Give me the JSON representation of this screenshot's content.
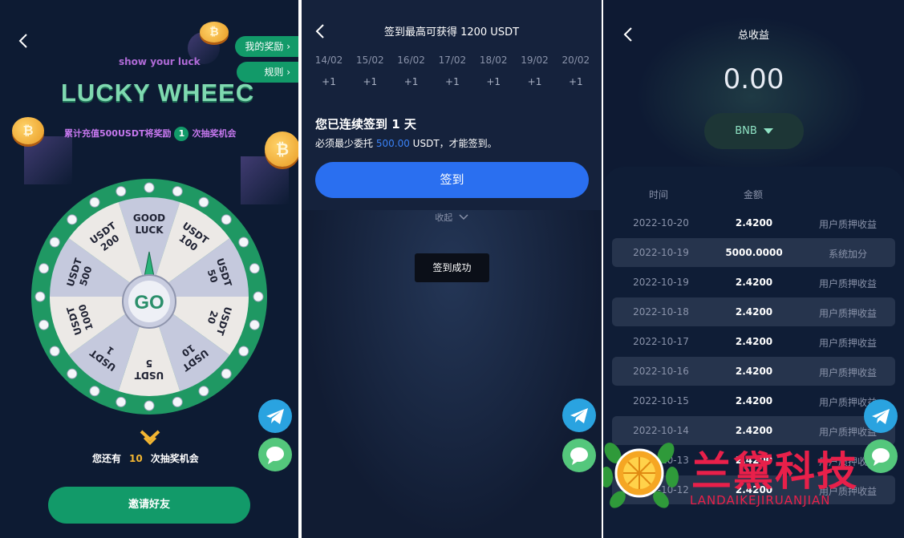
{
  "lucky_wheel": {
    "back_glyph": "‹",
    "my_rewards": "我的奖励",
    "rules": "规则",
    "subtitle": "show your luck",
    "title": "LUCKY WHEEC",
    "promo_prefix": "累计充值500USDT将奖励",
    "promo_count": "1",
    "promo_suffix": "次抽奖机会",
    "wheel_segments": [
      "GOOD LUCK",
      "USDT 100",
      "USDT 50",
      "USDT 20",
      "USDT 10",
      "USDT 5",
      "USDT 1",
      "USDT 1000",
      "USDT 500",
      "USDT 200"
    ],
    "go_label": "GO",
    "remain_prefix": "您还有",
    "remain_count": "10",
    "remain_suffix": "次抽奖机会",
    "invite_label": "邀请好友",
    "colors": {
      "accent": "#129a69",
      "bg": "#0d1b33"
    }
  },
  "checkin": {
    "back_glyph": "‹",
    "title": "签到最高可获得 1200 USDT",
    "days": [
      {
        "date": "14/02",
        "bonus": "+1"
      },
      {
        "date": "15/02",
        "bonus": "+1"
      },
      {
        "date": "16/02",
        "bonus": "+1"
      },
      {
        "date": "17/02",
        "bonus": "+1"
      },
      {
        "date": "18/02",
        "bonus": "+1"
      },
      {
        "date": "19/02",
        "bonus": "+1"
      },
      {
        "date": "20/02",
        "bonus": "+1"
      }
    ],
    "consecutive": "您已连续签到 1 天",
    "need_prefix": "必须最少委托",
    "need_amount": "500.00",
    "need_suffix": "USDT，才能签到。",
    "sign_button": "签到",
    "collapse": "收起",
    "toast": "签到成功",
    "colors": {
      "button": "#2a6ff0"
    }
  },
  "earnings": {
    "back_glyph": "‹",
    "title": "总收益",
    "total": "0.00",
    "coin": "BNB",
    "headers": {
      "time": "时间",
      "amount": "金额"
    },
    "rows": [
      {
        "date": "2022-10-20",
        "amount": "2.4200",
        "type": "用户质押收益"
      },
      {
        "date": "2022-10-19",
        "amount": "5000.0000",
        "type": "系统加分"
      },
      {
        "date": "2022-10-19",
        "amount": "2.4200",
        "type": "用户质押收益"
      },
      {
        "date": "2022-10-18",
        "amount": "2.4200",
        "type": "用户质押收益"
      },
      {
        "date": "2022-10-17",
        "amount": "2.4200",
        "type": "用户质押收益"
      },
      {
        "date": "2022-10-16",
        "amount": "2.4200",
        "type": "用户质押收益"
      },
      {
        "date": "2022-10-15",
        "amount": "2.4200",
        "type": "用户质押收益"
      },
      {
        "date": "2022-10-14",
        "amount": "2.4200",
        "type": "用户质押收益"
      },
      {
        "date": "2022-10-13",
        "amount": "2.4200",
        "type": "用户质押收益"
      },
      {
        "date": "2022-10-12",
        "amount": "2.4200",
        "type": "用户质押收益"
      }
    ],
    "watermark": "兰黛科技",
    "watermark_sub": "LANDAIKEJIRUANJIAN"
  },
  "icons": [
    "back-icon",
    "chevron-right-icon",
    "bitcoin-coin-icon",
    "telegram-icon",
    "chat-icon",
    "chevron-down-icon",
    "caret-down-icon",
    "orange-slice-logo-icon"
  ]
}
